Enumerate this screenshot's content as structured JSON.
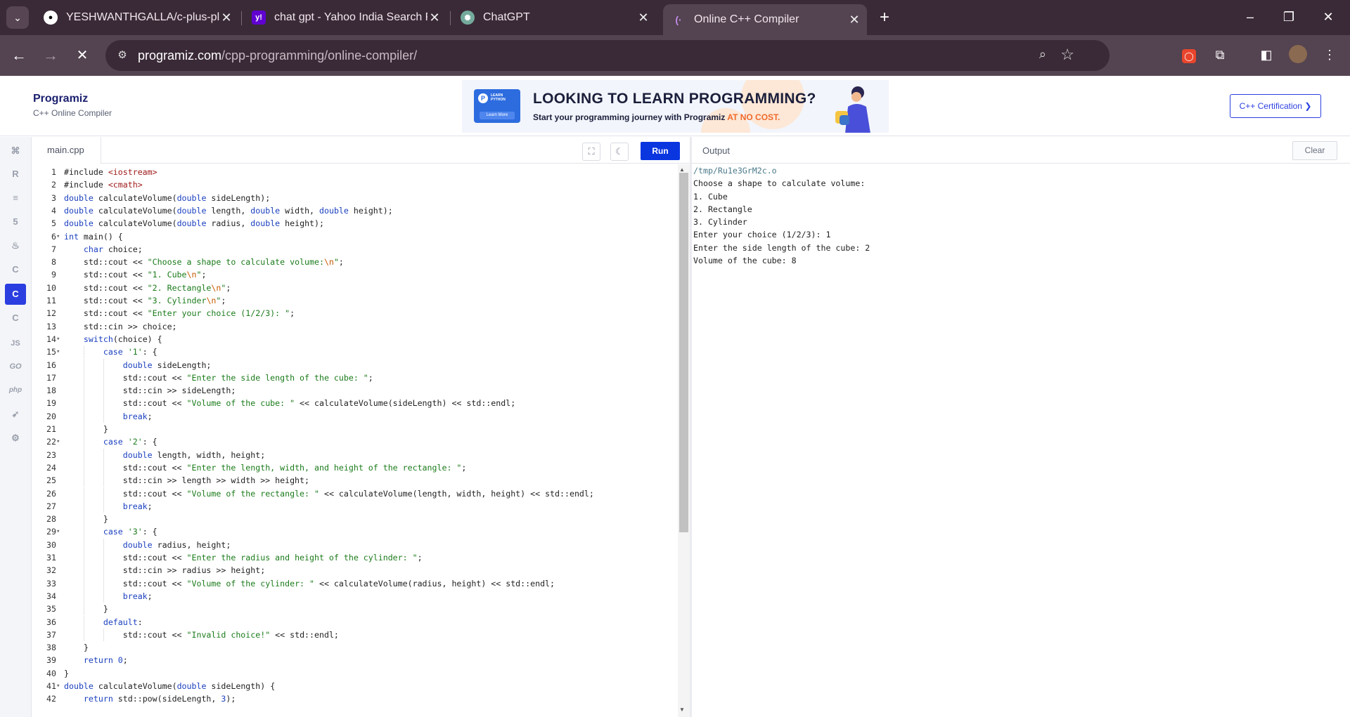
{
  "browser": {
    "tabs": [
      {
        "title": "YESHWANTHGALLA/c-plus-plus",
        "icon": "github-icon"
      },
      {
        "title": "chat gpt - Yahoo India Search Results",
        "icon": "yahoo-icon"
      },
      {
        "title": "ChatGPT",
        "icon": "chatgpt-icon"
      },
      {
        "title": "Online C++ Compiler",
        "icon": "programiz-icon"
      }
    ],
    "active_tab_index": 3,
    "url_host": "programiz.com",
    "url_path": "/cpp-programming/online-compiler/"
  },
  "header": {
    "brand": "Programiz",
    "subtitle": "C++ Online Compiler",
    "certification_label": "C++ Certification ❯"
  },
  "banner": {
    "card_line1": "LEARN",
    "card_line2": "PYTHON",
    "card_button": "Learn More",
    "headline": "LOOKING TO LEARN PROGRAMMING?",
    "tagline_prefix": "Start your programming journey with Programiz ",
    "tagline_highlight": "AT NO COST."
  },
  "languages": [
    "python",
    "r",
    "sql",
    "html",
    "java",
    "c",
    "cpp",
    "csharp",
    "javascript",
    "go",
    "php",
    "swift",
    "rust"
  ],
  "active_language": "cpp",
  "editor": {
    "filename": "main.cpp",
    "run_label": "Run",
    "code": [
      "#include <iostream>",
      "#include <cmath>",
      "double calculateVolume(double sideLength);",
      "double calculateVolume(double length, double width, double height);",
      "double calculateVolume(double radius, double height);",
      "int main() {",
      "    char choice;",
      "    std::cout << \"Choose a shape to calculate volume:\\n\";",
      "    std::cout << \"1. Cube\\n\";",
      "    std::cout << \"2. Rectangle\\n\";",
      "    std::cout << \"3. Cylinder\\n\";",
      "    std::cout << \"Enter your choice (1/2/3): \";",
      "    std::cin >> choice;",
      "    switch(choice) {",
      "        case '1': {",
      "            double sideLength;",
      "            std::cout << \"Enter the side length of the cube: \";",
      "            std::cin >> sideLength;",
      "            std::cout << \"Volume of the cube: \" << calculateVolume(sideLength) << std::endl;",
      "            break;",
      "        }",
      "        case '2': {",
      "            double length, width, height;",
      "            std::cout << \"Enter the length, width, and height of the rectangle: \";",
      "            std::cin >> length >> width >> height;",
      "            std::cout << \"Volume of the rectangle: \" << calculateVolume(length, width, height) << std::endl;",
      "            break;",
      "        }",
      "        case '3': {",
      "            double radius, height;",
      "            std::cout << \"Enter the radius and height of the cylinder: \";",
      "            std::cin >> radius >> height;",
      "            std::cout << \"Volume of the cylinder: \" << calculateVolume(radius, height) << std::endl;",
      "            break;",
      "        }",
      "        default:",
      "            std::cout << \"Invalid choice!\" << std::endl;",
      "    }",
      "    return 0;",
      "}",
      "double calculateVolume(double sideLength) {",
      "    return std::pow(sideLength, 3);"
    ],
    "foldable_lines": [
      6,
      14,
      15,
      22,
      29,
      41
    ]
  },
  "output": {
    "title": "Output",
    "clear_label": "Clear",
    "lines": [
      "/tmp/Ru1e3GrM2c.o",
      "Choose a shape to calculate volume:",
      "1. Cube",
      "2. Rectangle",
      "3. Cylinder",
      "Enter your choice (1/2/3): 1",
      "Enter the side length of the cube: 2",
      "Volume of the cube: 8"
    ]
  }
}
